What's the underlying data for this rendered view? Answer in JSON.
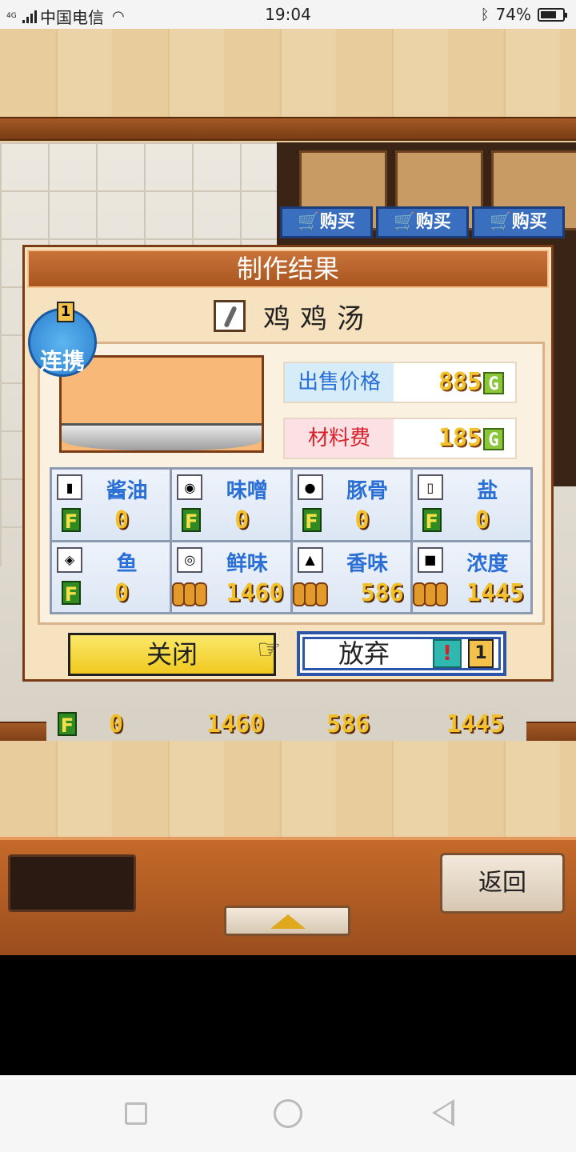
{
  "status_bar": {
    "network_type": "4G",
    "carrier": "中国电信",
    "time": "19:04",
    "battery": "74%",
    "battery_level": 0.74
  },
  "background": {
    "shop_buy_label": "购买",
    "back_label": "返回",
    "behind_row": {
      "val_0": "0",
      "val_1": "1460",
      "val_2": "586",
      "val_3": "1445"
    }
  },
  "dialog": {
    "title": "制作结果",
    "dish_name": "鸡鸡汤",
    "combo_label": "连携",
    "combo_count": "1",
    "sell_price_label": "出售价格",
    "sell_price_value": "885",
    "material_cost_label": "材料费",
    "material_cost_value": "185",
    "currency": "G",
    "stats": [
      {
        "name": "酱油",
        "icon": "soy-sauce-icon",
        "value": "0"
      },
      {
        "name": "味噌",
        "icon": "miso-icon",
        "value": "0"
      },
      {
        "name": "豚骨",
        "icon": "pork-bone-icon",
        "value": "0"
      },
      {
        "name": "盐",
        "icon": "salt-icon",
        "value": "0"
      },
      {
        "name": "鱼",
        "icon": "fish-icon",
        "value": "0"
      },
      {
        "name": "鲜味",
        "icon": "umami-icon",
        "value": "1460"
      },
      {
        "name": "香味",
        "icon": "aroma-icon",
        "value": "586"
      },
      {
        "name": "浓度",
        "icon": "richness-icon",
        "value": "1445"
      }
    ],
    "close_label": "关闭",
    "abandon_label": "放弃",
    "abandon_count": "1"
  },
  "colors": {
    "accent_blue": "#2a6fd6",
    "gold": "#f2c12a",
    "title_bar": "#a8551f"
  }
}
